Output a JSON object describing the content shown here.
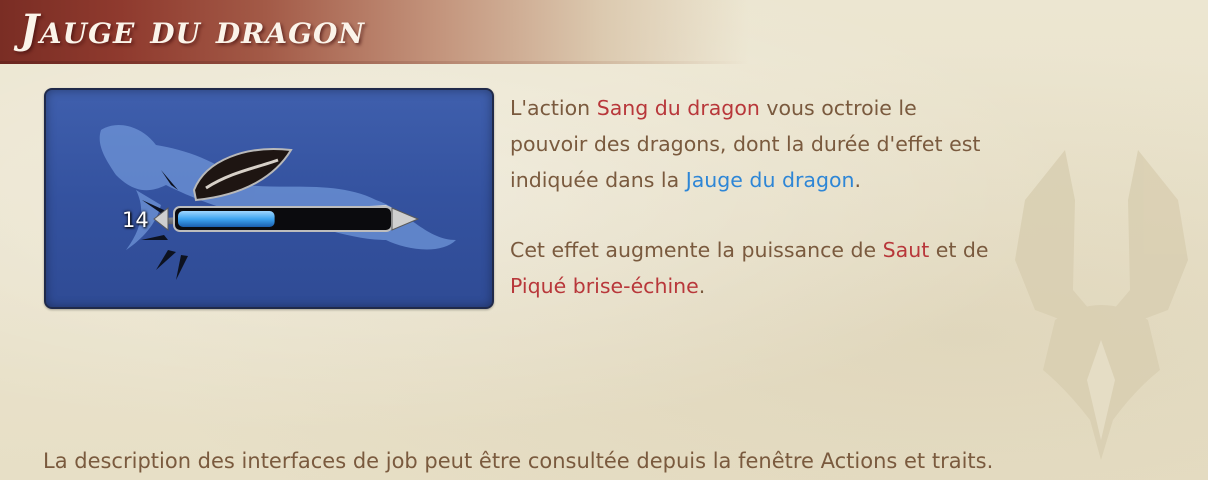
{
  "header": {
    "title": "Jauge du dragon"
  },
  "gauge": {
    "value": "14",
    "fill_fraction": 0.46,
    "fill_color": "#3ea4f0"
  },
  "description": {
    "para1": {
      "before": "L'action ",
      "highlight1": "Sang du dragon",
      "middle": " vous octroie le pouvoir des dragons, dont la durée d'effet est indiquée dans la ",
      "highlight2": "Jauge du dragon",
      "after": "."
    },
    "para2": {
      "before": "Cet effet augmente la puissance de ",
      "highlight1": "Saut",
      "middle": " et de ",
      "highlight2": "Piqué brise-échine",
      "after": "."
    }
  },
  "footer": {
    "text": "La description des interfaces de job peut être consultée depuis la fenêtre Actions et traits."
  },
  "colors": {
    "accent_red": "#b8373a",
    "accent_blue": "#2e86d6",
    "body_text": "#7a5a3e"
  },
  "icons": {
    "watermark": "dragoon-job-emblem-icon",
    "gauge": "dragon-gauge-icon"
  }
}
